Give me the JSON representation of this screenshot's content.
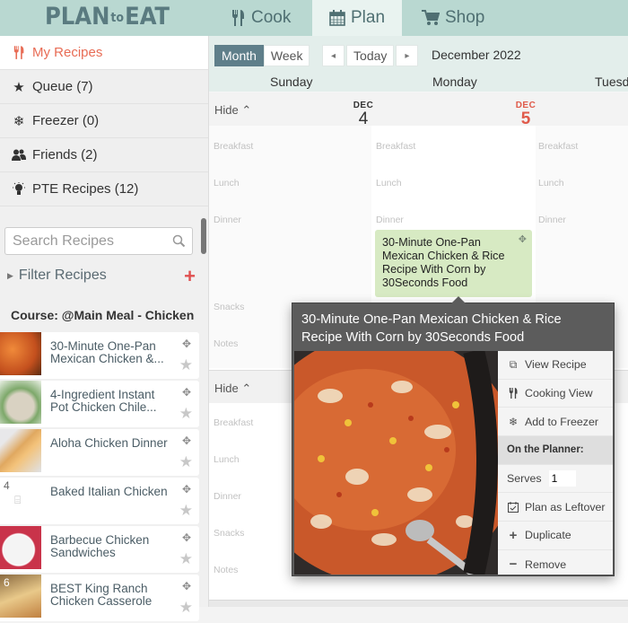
{
  "app": {
    "logo_left": "PLAN",
    "logo_mid": "to",
    "logo_right": "EAT"
  },
  "tabs": [
    {
      "label": "Cook",
      "icon": "utensils-icon",
      "active": false
    },
    {
      "label": "Plan",
      "icon": "calendar-icon",
      "active": true
    },
    {
      "label": "Shop",
      "icon": "cart-icon",
      "active": false
    }
  ],
  "sidebar": {
    "nav": [
      {
        "label": "My Recipes",
        "icon": "utensils-icon",
        "active": true
      },
      {
        "label": "Queue (7)",
        "icon": "star-icon"
      },
      {
        "label": "Freezer (0)",
        "icon": "snowflake-icon"
      },
      {
        "label": "Friends (2)",
        "icon": "users-icon"
      },
      {
        "label": "PTE Recipes (12)",
        "icon": "lightbulb-icon"
      }
    ],
    "search_placeholder": "Search Recipes",
    "filter_label": "Filter Recipes",
    "course_label": "Course: @Main Meal - Chicken",
    "recipes": [
      {
        "title": "30-Minute One-Pan Mexican Chicken &...",
        "thumb_num": ""
      },
      {
        "title": "4-Ingredient Instant Pot Chicken Chile...",
        "thumb_num": ""
      },
      {
        "title": "Aloha Chicken Dinner",
        "thumb_num": ""
      },
      {
        "title": "Baked Italian Chicken",
        "thumb_num": "4"
      },
      {
        "title": "Barbecue Chicken Sandwiches",
        "thumb_num": ""
      },
      {
        "title": "BEST King Ranch Chicken Casserole",
        "thumb_num": "6"
      }
    ]
  },
  "calendar": {
    "view_month": "Month",
    "view_week": "Week",
    "prev": "◂",
    "today": "Today",
    "next": "▸",
    "month_label": "December 2022",
    "day_names": [
      "Sunday",
      "Monday",
      "Tuesd"
    ],
    "hide_label": "Hide",
    "week1": {
      "days": [
        {
          "month": "DEC",
          "day": "4",
          "today": false
        },
        {
          "month": "DEC",
          "day": "5",
          "today": true
        }
      ]
    },
    "slots": [
      "Breakfast",
      "Lunch",
      "Dinner",
      "Snacks",
      "Notes"
    ],
    "event": {
      "title": "30-Minute One-Pan Mexican Chicken & Rice Recipe With Corn by 30Seconds Food"
    },
    "today_color": "#e05a4a"
  },
  "popup": {
    "title": "30-Minute One-Pan Mexican Chicken & Rice Recipe With Corn by 30Seconds Food",
    "menu": {
      "view_recipe": "View Recipe",
      "cooking_view": "Cooking View",
      "add_freezer": "Add to Freezer",
      "section": "On the Planner:",
      "serves_label": "Serves",
      "serves_value": "1",
      "leftover": "Plan as Leftover",
      "duplicate": "Duplicate",
      "remove": "Remove"
    }
  }
}
